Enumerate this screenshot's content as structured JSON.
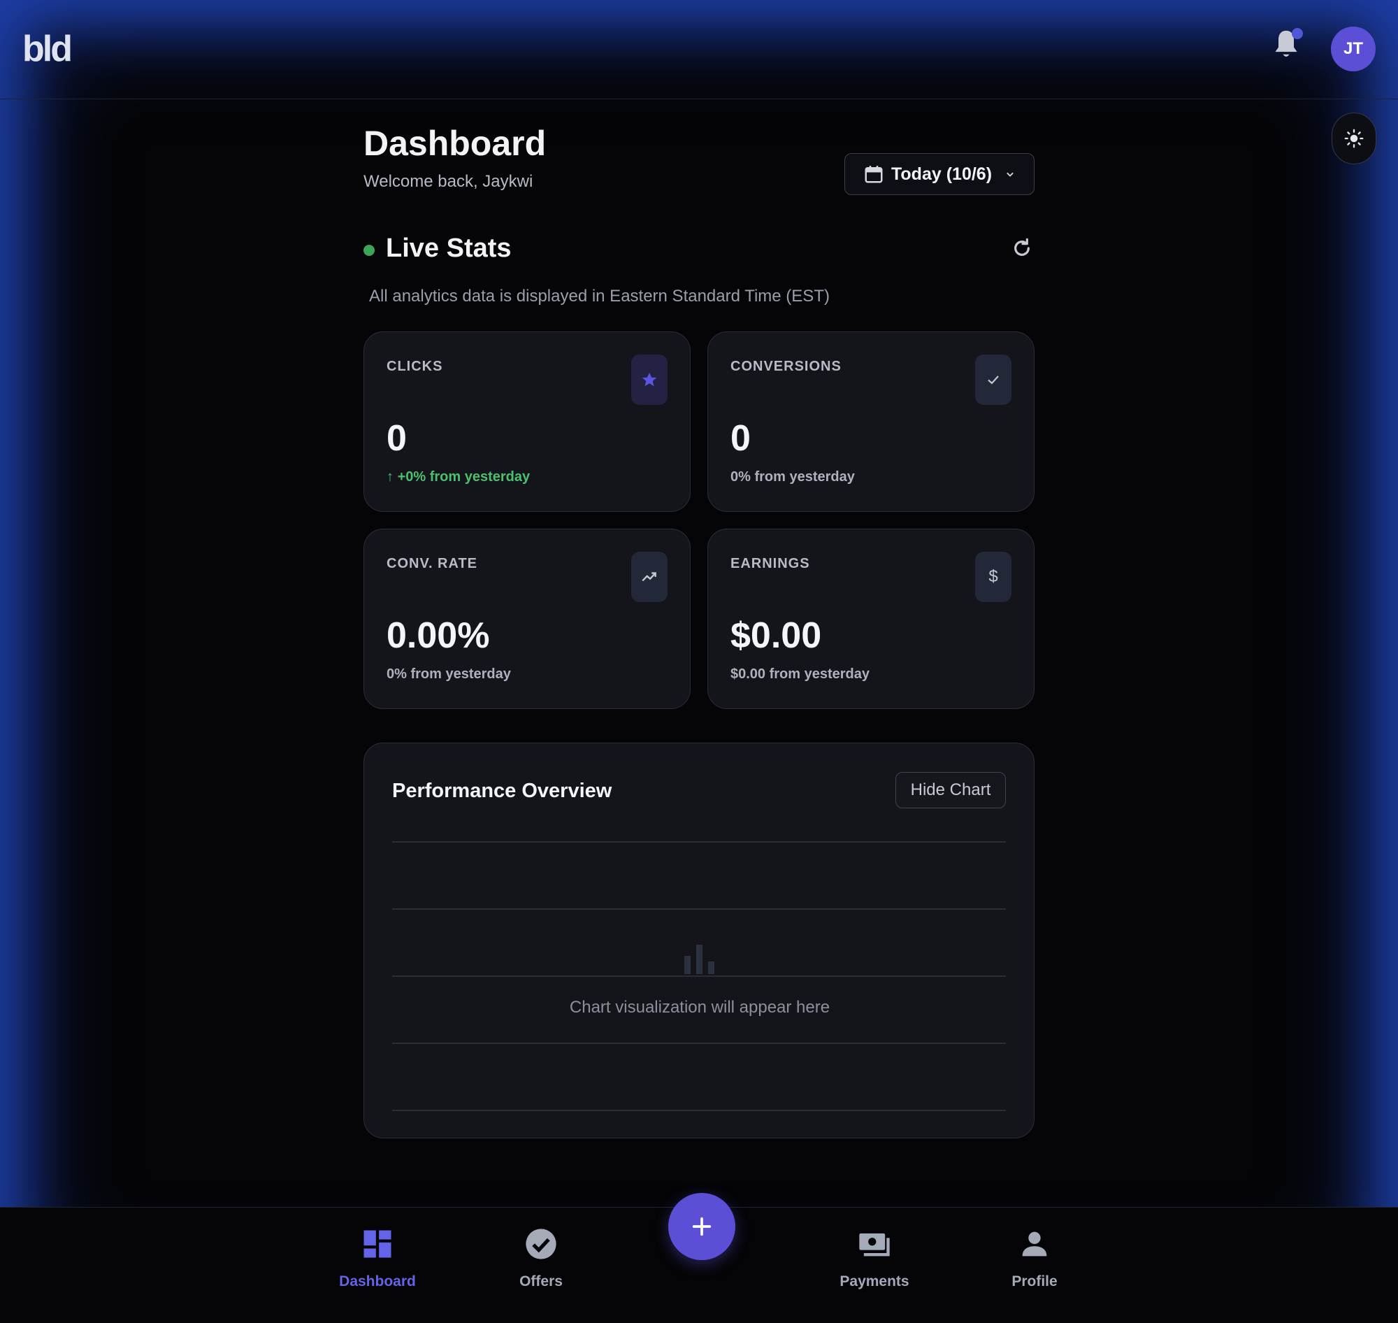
{
  "app": {
    "logo": "bld",
    "avatar_initials": "JT"
  },
  "header": {
    "title": "Dashboard",
    "subtitle": "Welcome back, Jaykwi",
    "date_filter": "Today (10/6)"
  },
  "live_stats": {
    "title": "Live Stats",
    "timezone_note": "All analytics data is displayed in Eastern Standard Time (EST)",
    "cards": [
      {
        "label": "CLICKS",
        "value": "0",
        "change": "+0% from yesterday",
        "icon": "star-icon"
      },
      {
        "label": "CONVERSIONS",
        "value": "0",
        "change": "0% from yesterday",
        "icon": "check-icon"
      },
      {
        "label": "CONV. RATE",
        "value": "0.00%",
        "change": "0% from yesterday",
        "icon": "trending-up-icon"
      },
      {
        "label": "EARNINGS",
        "value": "$0.00",
        "change": "$0.00 from yesterday",
        "icon": "dollar-icon"
      }
    ]
  },
  "performance": {
    "title": "Performance Overview",
    "hide_button": "Hide Chart",
    "empty_text": "Chart visualization will appear here"
  },
  "nav": {
    "items": [
      {
        "label": "Dashboard",
        "icon": "dashboard-icon",
        "active": true
      },
      {
        "label": "Offers",
        "icon": "check-circle-icon"
      },
      {
        "label": "Payments",
        "icon": "payments-icon"
      },
      {
        "label": "Profile",
        "icon": "person-icon"
      }
    ],
    "fab_icon": "plus-icon"
  },
  "colors": {
    "accent": "#5b4fd6",
    "positive": "#4cc06e",
    "live": "#3aa655"
  }
}
